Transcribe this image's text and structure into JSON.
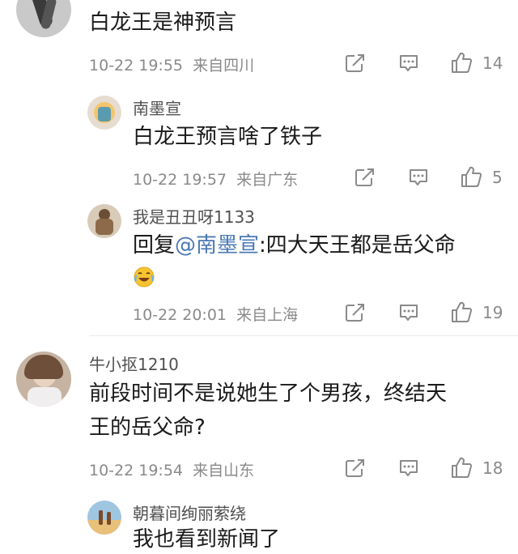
{
  "comments": [
    {
      "name": "",
      "text": "白龙王是神预言",
      "time": "10-22 19:55",
      "location": "来自四川",
      "likes": "14",
      "icons": [
        "share-icon",
        "comment-icon",
        "like-icon"
      ]
    },
    {
      "name": "南墨宣",
      "text": "白龙王预言啥了铁子",
      "time": "10-22 19:57",
      "location": "来自广东",
      "likes": "5",
      "icons": [
        "share-icon",
        "comment-icon",
        "like-icon"
      ]
    },
    {
      "name": "我是丑丑呀1133",
      "reply_prefix": "回复",
      "mention": "@南墨宣",
      "text": ":四大天王都是岳父命",
      "emoji": "laugh-cry-emoji",
      "time": "10-22 20:01",
      "location": "来自上海",
      "likes": "19",
      "icons": [
        "share-icon",
        "comment-icon",
        "like-icon"
      ]
    },
    {
      "name": "牛小抠1210",
      "text_line1": "前段时间不是说她生了个男孩，终结天",
      "text_line2": "王的岳父命?",
      "time": "10-22 19:54",
      "location": "来自山东",
      "likes": "18",
      "icons": [
        "share-icon",
        "comment-icon",
        "like-icon"
      ]
    },
    {
      "name": "朝暮间绚丽萦绕",
      "text": "我也看到新闻了"
    }
  ],
  "colors": {
    "mention": "#4a78b5",
    "meta": "#8a8a8a",
    "divider": "#ececec"
  }
}
